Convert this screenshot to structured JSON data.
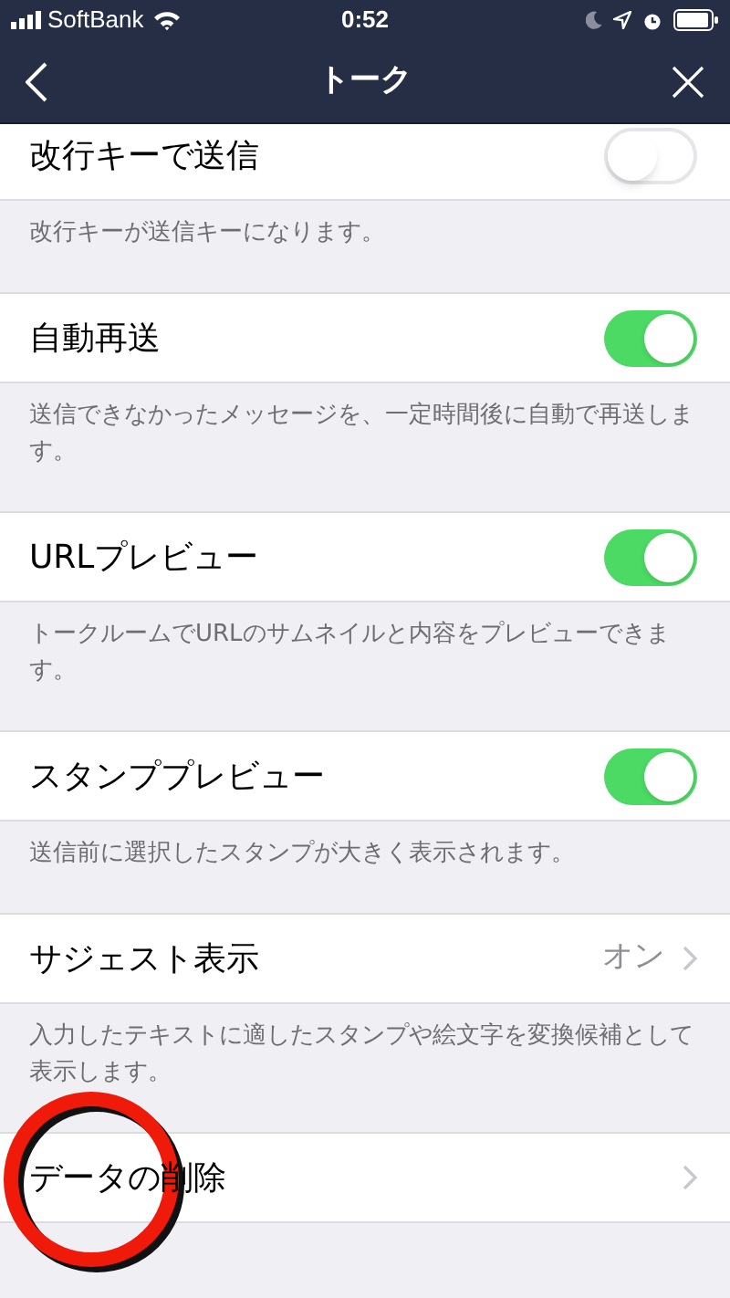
{
  "status_bar": {
    "carrier": "SoftBank",
    "time": "0:52"
  },
  "nav": {
    "title": "トーク"
  },
  "settings": [
    {
      "kind": "toggle",
      "title": "改行キーで送信",
      "on": false,
      "description": "改行キーが送信キーになります。"
    },
    {
      "kind": "toggle",
      "title": "自動再送",
      "on": true,
      "description": "送信できなかったメッセージを、一定時間後に自動で再送します。"
    },
    {
      "kind": "toggle",
      "title": "URLプレビュー",
      "on": true,
      "description": "トークルームでURLのサムネイルと内容をプレビューできます。"
    },
    {
      "kind": "toggle",
      "title": "スタンププレビュー",
      "on": true,
      "description": "送信前に選択したスタンプが大きく表示されます。"
    },
    {
      "kind": "link",
      "title": "サジェスト表示",
      "value": "オン",
      "description": "入力したテキストに適したスタンプや絵文字を変換候補として表示します。"
    },
    {
      "kind": "link",
      "title": "データの削除"
    }
  ]
}
